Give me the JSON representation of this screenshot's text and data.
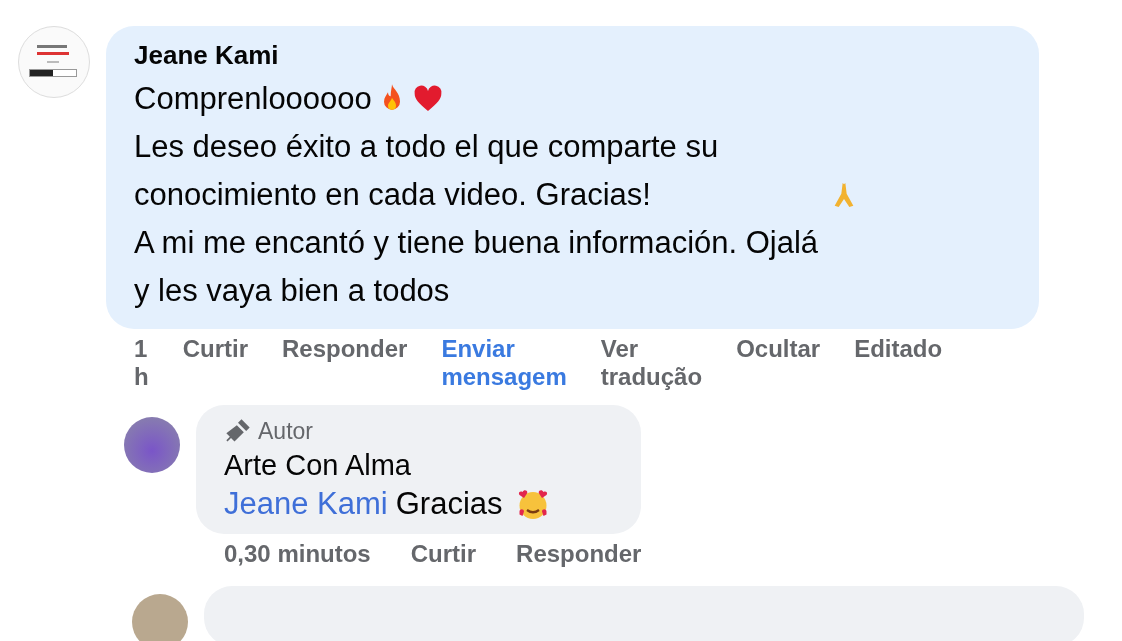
{
  "comment": {
    "author": "Jeane Kami",
    "paragraphs": [
      "Comprenloooooo",
      "Les deseo éxito a todo el que comparte su conocimiento en cada video. Gracias!",
      "A mi me encantó y tiene buena información. Ojalá y les vaya bien a todos"
    ],
    "actions": [
      {
        "label": "1 h",
        "highlighted": false
      },
      {
        "label": "Curtir",
        "highlighted": false
      },
      {
        "label": "Responder",
        "highlighted": false
      },
      {
        "label": "Enviar mensagem",
        "highlighted": true
      },
      {
        "label": "Ver tradução",
        "highlighted": false
      },
      {
        "label": "Ocultar",
        "highlighted": false
      },
      {
        "label": "Editado",
        "highlighted": false
      }
    ]
  },
  "reply": {
    "badge": "Autor",
    "author": "Arte Con Alma",
    "mention": "Jeane Kami",
    "text": "Gracias",
    "actions": [
      "0,30 minutos",
      "Curtir",
      "Responder"
    ]
  }
}
